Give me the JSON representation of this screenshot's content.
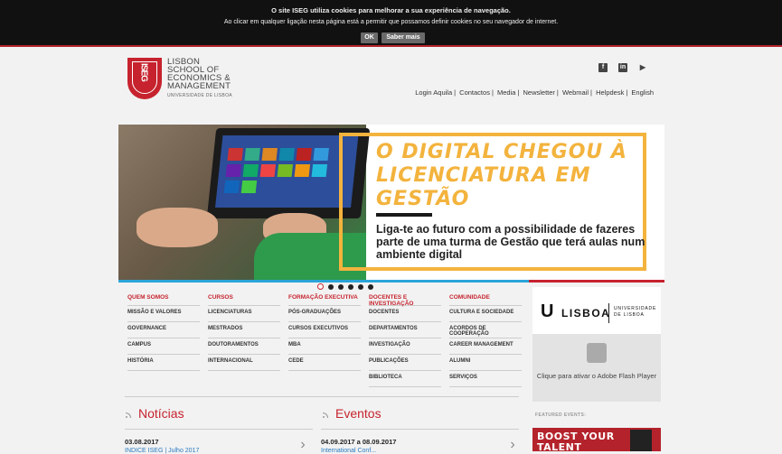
{
  "cookie_bar": {
    "line1": "O site ISEG utiliza cookies para melhorar a sua experiência de navegação.",
    "line2": "Ao clicar em qualquer ligação nesta página está a permitir que possamos definir cookies no seu navegador de internet.",
    "ok_label": "OK",
    "more_label": "Saber mais"
  },
  "logo": {
    "shield_text": "ISEG",
    "line1": "LISBON",
    "line2": "SCHOOL OF",
    "line3": "ECONOMICS &",
    "line4": "MANAGEMENT",
    "sub": "UNIVERSIDADE DE LISBOA"
  },
  "social": {
    "facebook": "f",
    "linkedin": "in",
    "youtube": "▶"
  },
  "top_links": [
    "Login Aquila",
    "Contactos",
    "Media",
    "Newsletter",
    "Webmail",
    "Helpdesk",
    "English"
  ],
  "banner": {
    "headline": "O DIGITAL CHEGOU À LICENCIATURA EM GESTÃO",
    "subline": "Liga-te ao futuro com a possibilidade de fazeres parte de uma turma de Gestão que terá aulas num ambiente digital",
    "slide_count": 6,
    "active_slide": 1,
    "colors": {
      "accent": "#f3b33d",
      "red": "#c6232e",
      "blue": "#2aa4d8"
    }
  },
  "menu": [
    {
      "heading": "QUEM SOMOS",
      "items": [
        "MISSÃO E VALORES",
        "GOVERNANCE",
        "CAMPUS",
        "HISTÓRIA"
      ]
    },
    {
      "heading": "CURSOS",
      "items": [
        "LICENCIATURAS",
        "MESTRADOS",
        "DOUTORAMENTOS",
        "INTERNACIONAL"
      ]
    },
    {
      "heading": "FORMAÇÃO EXECUTIVA",
      "items": [
        "PÓS-GRADUAÇÕES",
        "CURSOS EXECUTIVOS",
        "MBA",
        "CEDE"
      ]
    },
    {
      "heading": "DOCENTES E INVESTIGAÇÃO",
      "items": [
        "DOCENTES",
        "DEPARTAMENTOS",
        "INVESTIGAÇÃO",
        "PUBLICAÇÕES",
        "BIBLIOTECA"
      ]
    },
    {
      "heading": "COMUNIDADE",
      "items": [
        "CULTURA E SOCIEDADE",
        "ACORDOS DE COOPERAÇÃO",
        "CAREER MANAGEMENT",
        "ALUMNI",
        "SERVIÇOS"
      ]
    }
  ],
  "sidebar": {
    "ulisboa_mark": "U",
    "ulisboa_word": "LISBOA",
    "ulisboa_sub1": "UNIVERSIDADE",
    "ulisboa_sub2": "DE LISBOA",
    "flash_text": "Clique para ativar o Adobe Flash Player",
    "featured_label": "FEATURED EVENTS:",
    "boost_line1": "BOOST YOUR",
    "boost_line2": "TALENT"
  },
  "news": {
    "title": "Notícias",
    "date": "03.08.2017",
    "snippet": "INDICE ISEG | Julho 2017"
  },
  "events": {
    "title": "Eventos",
    "date": "04.09.2017 a 08.09.2017",
    "snippet": "International Conf..."
  }
}
